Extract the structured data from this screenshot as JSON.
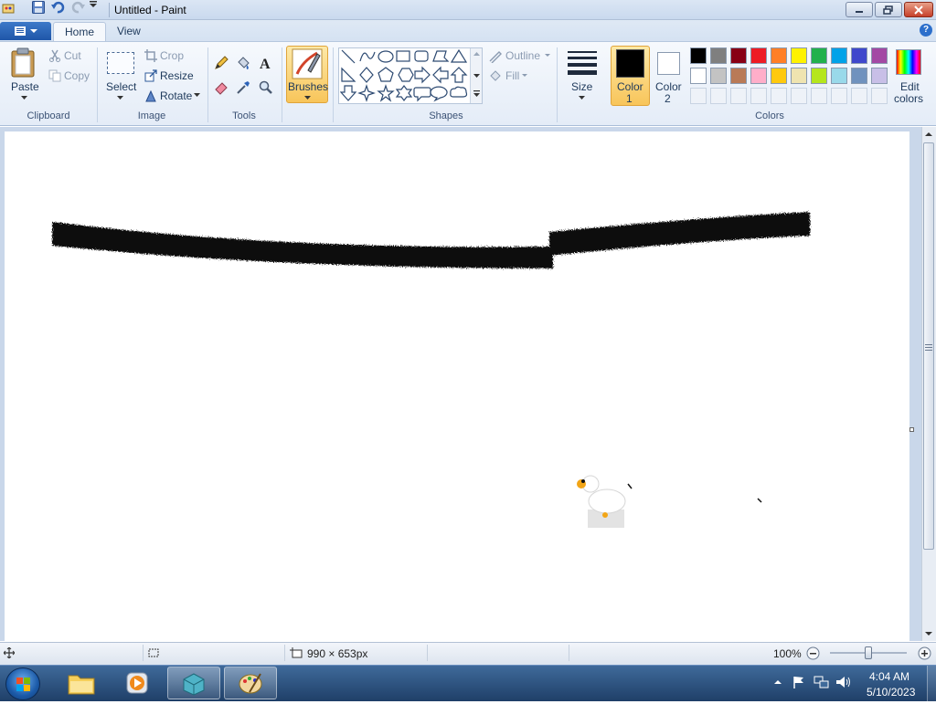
{
  "window": {
    "title": "Untitled - Paint",
    "quick_access": [
      "save-icon",
      "undo-icon",
      "redo-icon",
      "customize-icon"
    ]
  },
  "tabs": {
    "home": "Home",
    "view": "View"
  },
  "ribbon": {
    "clipboard": {
      "paste": "Paste",
      "cut": "Cut",
      "copy": "Copy",
      "label": "Clipboard"
    },
    "image": {
      "select": "Select",
      "crop": "Crop",
      "resize": "Resize",
      "rotate": "Rotate",
      "label": "Image"
    },
    "tools": {
      "label": "Tools"
    },
    "brushes": {
      "label": "Brushes"
    },
    "shapes": {
      "outline": "Outline",
      "fill": "Fill",
      "label": "Shapes"
    },
    "size": {
      "label": "Size"
    },
    "color1": {
      "label1": "Color",
      "label2": "1",
      "value": "#000000"
    },
    "color2": {
      "label1": "Color",
      "label2": "2",
      "value": "#ffffff"
    },
    "colors": {
      "label": "Colors",
      "edit1": "Edit",
      "edit2": "colors"
    },
    "palette_row1": [
      "#000000",
      "#7f7f7f",
      "#880015",
      "#ed1c24",
      "#ff7f27",
      "#fff200",
      "#22b14c",
      "#00a2e8",
      "#3f48cc",
      "#a349a4"
    ],
    "palette_row2": [
      "#ffffff",
      "#c3c3c3",
      "#b97a57",
      "#ffaec9",
      "#ffc90e",
      "#efe4b0",
      "#b5e61d",
      "#99d9ea",
      "#7092be",
      "#c8bfe7"
    ]
  },
  "status": {
    "canvas_size": "990 × 653px",
    "zoom": "100%"
  },
  "taskbar": {
    "time": "4:04 AM",
    "date": "5/10/2023"
  }
}
